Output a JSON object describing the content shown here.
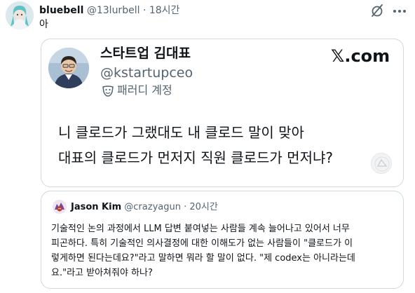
{
  "tweet": {
    "author_name": "bluebell",
    "handle": "@13lurbell",
    "separator": "·",
    "time": "18시간",
    "text": "아"
  },
  "card": {
    "author_name": "스타트업 김대표",
    "handle": "@kstartupceo",
    "parody_label": "패러디 계정",
    "brand": "𝕏.com",
    "line1": "니 클로드가 그랬대도 내 클로드 말이 맞아",
    "line2": "대표의 클로드가 먼저지 직원 클로드가 먼저냐?"
  },
  "quote": {
    "author_name": "Jason Kim",
    "handle": "@crazyagun",
    "separator": "·",
    "time": "20시간",
    "lines": [
      "기술적인 논의 과정에서 LLM 답변 붙여넣는 사람들 계속 늘어나고 있어서 너무",
      "피곤하다. 특히 기술적인 의사결정에 대한 이해도가 없는 사람들이 \"클로드가 이",
      "렇게하면 된다는데요?\"라고 말하면 뭐라 할 말이 없다. \"제 codex는 아니라는데",
      "요.\"라고 받아쳐줘야 하나?"
    ]
  },
  "icons": {
    "mute": "grok-slash-icon",
    "more": "more-dots-icon",
    "parody": "parody-mask-icon"
  },
  "colors": {
    "text": "#0f1419",
    "secondary": "#536471",
    "border": "#cfd9de"
  }
}
